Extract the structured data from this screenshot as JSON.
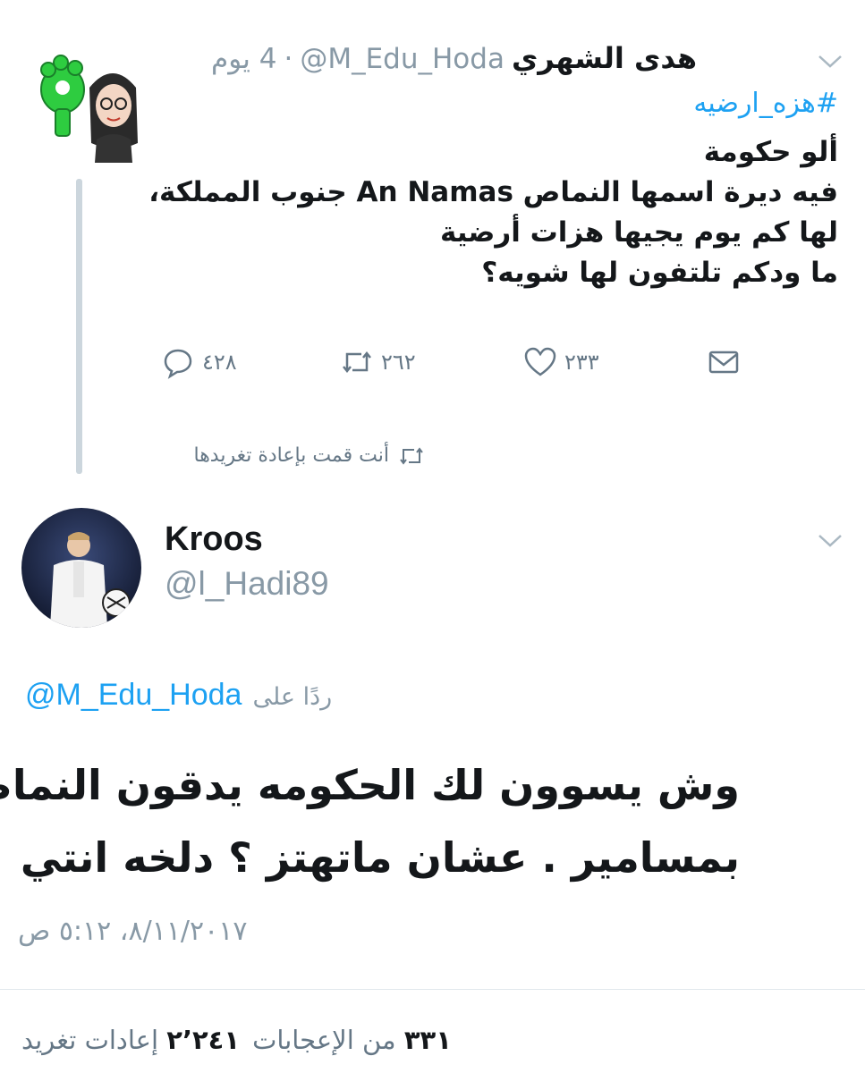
{
  "tweet1": {
    "name": "هدى الشهري",
    "handle": "@M_Edu_Hoda",
    "separator": "·",
    "time": "4 يوم",
    "hashtag": "#هزه_ارضيه",
    "lines": [
      "ألو حكومة",
      "فيه ديرة اسمها النماص An Namas جنوب المملكة،",
      "لها كم يوم يجيها هزات أرضية",
      "ما ودكم تلتفون لها شويه؟"
    ],
    "actions": {
      "reply_count": "٤٢٨",
      "retweet_count": "٢٦٢",
      "like_count": "٢٣٣"
    },
    "retweet_note": "أنت قمت بإعادة تغريدها"
  },
  "tweet2": {
    "name": "Kroos",
    "handle": "@l_Hadi89",
    "replying_label": "ردًا على",
    "replying_handle": "@M_Edu_Hoda",
    "lines": [
      "وش يسوون لك الحكومه يدقون النماص",
      "بمسامير . عشان ماتهتز ؟ دلخه انتي"
    ],
    "timestamp": "٨/١١/٢٠١٧، ٥:١٢ ص",
    "stats": {
      "likes_count": "٣٣١",
      "likes_label": "من الإعجابات",
      "retweets_count": "٢٬٢٤١",
      "retweets_label": "إعادات تغريد"
    }
  },
  "colors": {
    "accent": "#1da1f2",
    "muted": "#8899a6",
    "glove": "#2ecc40"
  }
}
